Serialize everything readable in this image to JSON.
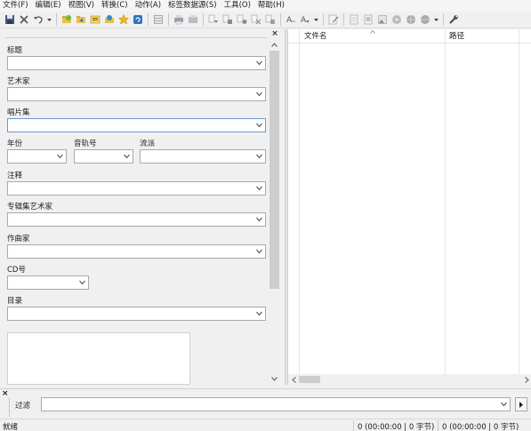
{
  "menu": [
    "文件(F)",
    "编辑(E)",
    "视图(V)",
    "转换(C)",
    "动作(A)",
    "标签数据源(S)",
    "工具(O)",
    "帮助(H)"
  ],
  "toolbar": {
    "icons": [
      "save-icon",
      "delete-icon",
      "undo-icon",
      "dropdown-arrow-icon",
      "open-folder-icon",
      "browse-folder-icon",
      "save-playlist-icon",
      "web-folder-icon",
      "favorite-star-icon",
      "refresh-icon",
      "grid-icon",
      "print-icon",
      "export-icon",
      "tag-to-filename-icon",
      "filename-to-tag-icon",
      "tag-to-tag-icon",
      "text-file-icon",
      "tag-sources-icon",
      "case-conversion-icon",
      "case-dropdown-icon",
      "edit-doc-icon",
      "doc-icon",
      "list-icon",
      "image-icon",
      "disc-icon",
      "globe-icon",
      "globe-dropdown-icon",
      "settings-wrench-icon"
    ]
  },
  "tag_panel": {
    "close_glyph": "×",
    "fields": {
      "title": {
        "label": "标题",
        "value": ""
      },
      "artist": {
        "label": "艺术家",
        "value": ""
      },
      "album": {
        "label": "唱片集",
        "value": ""
      },
      "year": {
        "label": "年份",
        "value": ""
      },
      "track": {
        "label": "音轨号",
        "value": ""
      },
      "genre": {
        "label": "流派",
        "value": ""
      },
      "comment": {
        "label": "注释",
        "value": ""
      },
      "album_artist": {
        "label": "专辑集艺术家",
        "value": ""
      },
      "composer": {
        "label": "作曲家",
        "value": ""
      },
      "disc_number": {
        "label": "CD号",
        "value": ""
      },
      "directory": {
        "label": "目录",
        "value": ""
      }
    }
  },
  "file_list": {
    "columns": [
      "文件名",
      "路径"
    ]
  },
  "filter": {
    "close_glyph": "×",
    "label": "过滤",
    "value": ""
  },
  "status": {
    "ready": "就绪",
    "selected": "0 (00:00:00 | 0 字节)",
    "total": "0 (00:00:00 | 0 字节)"
  },
  "colors": {
    "accent": "#1e6fd0",
    "focus_border": "#6b9bd1",
    "star": "#f2b51b",
    "folder": "#6dbb3f"
  }
}
